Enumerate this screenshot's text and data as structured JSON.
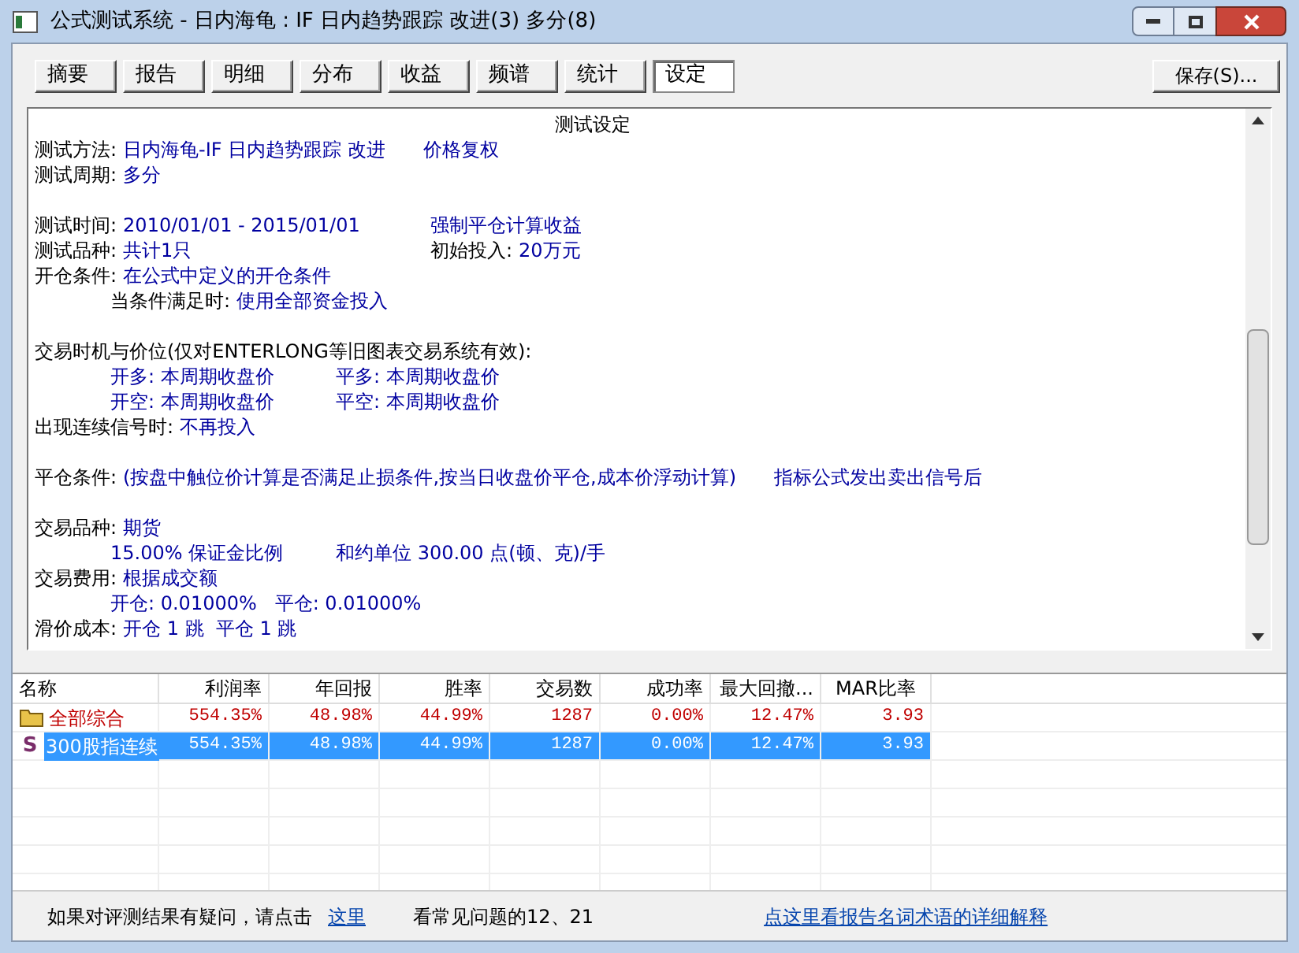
{
  "window": {
    "title": "公式测试系统 - 日内海龟 : IF 日内趋势跟踪 改进(3) 多分(8)"
  },
  "tabs": [
    {
      "label": "摘要",
      "selected": false
    },
    {
      "label": "报告",
      "selected": false
    },
    {
      "label": "明细",
      "selected": false
    },
    {
      "label": "分布",
      "selected": false
    },
    {
      "label": "收益",
      "selected": false
    },
    {
      "label": "频谱",
      "selected": false
    },
    {
      "label": "统计",
      "selected": false
    },
    {
      "label": "设定",
      "selected": true
    }
  ],
  "save_button": "保存(S)...",
  "report": {
    "title": "测试设定",
    "sections": [
      [
        {
          "kind": "plain",
          "left": [
            {
              "kind": "label",
              "text": "测试方法:"
            },
            {
              "kind": "value",
              "text": "日内海龟-IF 日内趋势跟踪 改进"
            },
            {
              "kind": "value",
              "text": "价格复权"
            }
          ]
        },
        {
          "kind": "plain",
          "left": [
            {
              "kind": "label",
              "text": "测试周期:"
            },
            {
              "kind": "value",
              "text": "多分"
            }
          ]
        }
      ],
      [
        {
          "kind": "plain",
          "left": [
            {
              "kind": "label",
              "text": "测试时间:"
            },
            {
              "kind": "value",
              "text": "2010/01/01 - 2015/01/01"
            }
          ],
          "right": [
            {
              "kind": "value",
              "text": "强制平仓计算收益"
            }
          ]
        },
        {
          "kind": "plain",
          "left": [
            {
              "kind": "label",
              "text": "测试品种:"
            },
            {
              "kind": "value",
              "text": "共计1只"
            }
          ],
          "right": [
            {
              "kind": "label",
              "text": "初始投入:"
            },
            {
              "kind": "value",
              "text": "20万元"
            }
          ]
        },
        {
          "kind": "plain",
          "left": [
            {
              "kind": "label",
              "text": "开仓条件:"
            },
            {
              "kind": "value",
              "text": "在公式中定义的开仓条件"
            }
          ]
        },
        {
          "kind": "indented",
          "left": [
            {
              "kind": "label",
              "text": "当条件满足时:"
            },
            {
              "kind": "value",
              "text": "使用全部资金投入"
            }
          ]
        }
      ],
      [
        {
          "kind": "plain",
          "left": [
            {
              "kind": "label",
              "text": "交易时机与价位(仅对ENTERLONG等旧图表交易系统有效):"
            }
          ]
        },
        {
          "kind": "indented",
          "left": [
            {
              "kind": "value",
              "text": "开多: 本周期收盘价"
            }
          ],
          "right": [
            {
              "kind": "value",
              "text": "平多: 本周期收盘价"
            }
          ]
        },
        {
          "kind": "indented",
          "left": [
            {
              "kind": "value",
              "text": "开空: 本周期收盘价"
            }
          ],
          "right": [
            {
              "kind": "value",
              "text": "平空: 本周期收盘价"
            }
          ]
        },
        {
          "kind": "plain",
          "left": [
            {
              "kind": "label",
              "text": "出现连续信号时:"
            },
            {
              "kind": "value",
              "text": "不再投入"
            }
          ]
        }
      ],
      [
        {
          "kind": "plain",
          "left": [
            {
              "kind": "label",
              "text": "平仓条件:"
            },
            {
              "kind": "value",
              "text": "(按盘中触位价计算是否满足止损条件,按当日收盘价平仓,成本价浮动计算)"
            },
            {
              "kind": "value",
              "text": "指标公式发出卖出信号后"
            }
          ]
        }
      ],
      [
        {
          "kind": "plain",
          "left": [
            {
              "kind": "label",
              "text": "交易品种:"
            },
            {
              "kind": "value",
              "text": "期货"
            }
          ]
        },
        {
          "kind": "indented",
          "left": [
            {
              "kind": "value",
              "text": "15.00% 保证金比例"
            }
          ],
          "right": [
            {
              "kind": "value",
              "text": "和约单位 300.00 点(顿、克)/手"
            }
          ]
        },
        {
          "kind": "plain",
          "left": [
            {
              "kind": "label",
              "text": "交易费用:"
            },
            {
              "kind": "value",
              "text": "根据成交额"
            }
          ]
        },
        {
          "kind": "indented",
          "left": [
            {
              "kind": "value",
              "text": "开仓: 0.01000%   平仓: 0.01000%"
            }
          ]
        },
        {
          "kind": "plain",
          "left": [
            {
              "kind": "label",
              "text": "滑价成本:"
            },
            {
              "kind": "value",
              "text": "开仓 1 跳  平仓 1 跳"
            }
          ]
        }
      ]
    ]
  },
  "table": {
    "columns": [
      "名称",
      "利润率",
      "年回报",
      "胜率",
      "交易数",
      "成功率",
      "最大回撤...",
      "MAR比率"
    ],
    "rows": [
      {
        "kind": "group",
        "selected": false,
        "cells": [
          "全部综合",
          "554.35%",
          "48.98%",
          "44.99%",
          "1287",
          "0.00%",
          "12.47%",
          "3.93"
        ]
      },
      {
        "kind": "item",
        "icon": "S",
        "selected": true,
        "cells": [
          "300股指连续",
          "554.35%",
          "48.98%",
          "44.99%",
          "1287",
          "0.00%",
          "12.47%",
          "3.93"
        ]
      }
    ]
  },
  "footer": {
    "question": "如果对评测结果有疑问，请点击",
    "here_link": "这里",
    "faq": "看常见问题的12、21",
    "glossary_link": "点这里看报告名词术语的详细解释"
  }
}
